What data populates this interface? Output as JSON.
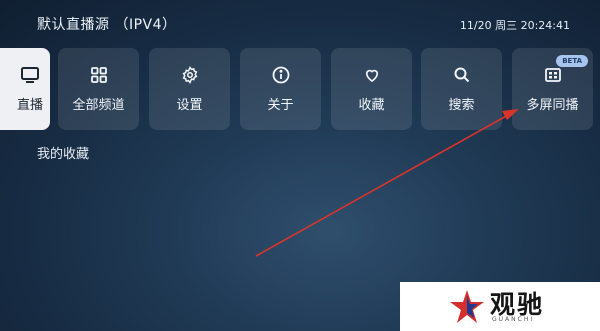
{
  "header": {
    "source_title": "默认直播源 （IPV4）",
    "clock": "11/20 周三 20:24:41"
  },
  "tiles": [
    {
      "label": "直播",
      "icon": "tv-icon",
      "active": true
    },
    {
      "label": "全部频道",
      "icon": "grid-icon"
    },
    {
      "label": "设置",
      "icon": "gear-icon"
    },
    {
      "label": "关于",
      "icon": "info-icon"
    },
    {
      "label": "收藏",
      "icon": "heart-icon"
    },
    {
      "label": "搜索",
      "icon": "search-icon"
    },
    {
      "label": "多屏同播",
      "icon": "multiscreen-icon",
      "badge": "BETA"
    }
  ],
  "favorites": {
    "title": "我的收藏"
  },
  "watermark": {
    "logo_text": "观驰",
    "logo_sub": "GUANCHI"
  },
  "colors": {
    "background": "#1b3048",
    "tile": "#2c3f55",
    "active_tile": "#eef0f3",
    "arrow": "#d9342b",
    "beta_badge": "#a7c5ec"
  }
}
